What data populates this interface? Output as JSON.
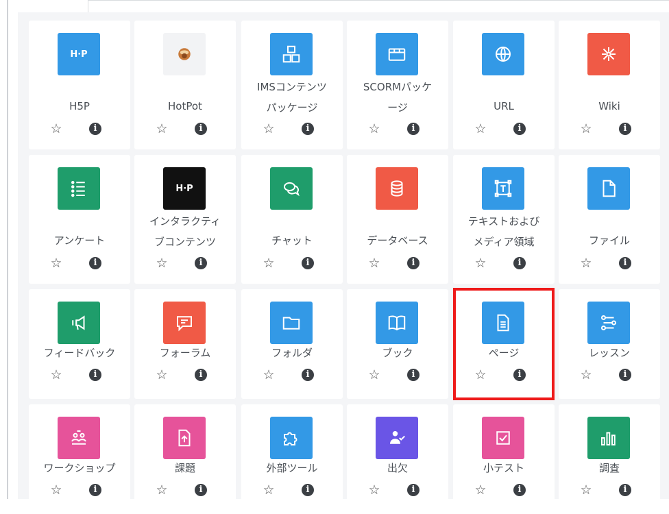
{
  "activities": [
    {
      "label": "H5P",
      "icon": "h5p-icon",
      "color": "#3399e6",
      "glyph": "H·P"
    },
    {
      "label": "HotPot",
      "icon": "hotpot-icon",
      "color": "#f2f3f5",
      "glyph": ""
    },
    {
      "label": "IMSコンテンツ\nパッケージ",
      "icon": "ims-package-icon",
      "color": "#3399e6",
      "glyph": ""
    },
    {
      "label": "SCORMパッケ\nージ",
      "icon": "scorm-package-icon",
      "color": "#3399e6",
      "glyph": ""
    },
    {
      "label": "URL",
      "icon": "globe-icon",
      "color": "#3399e6",
      "glyph": ""
    },
    {
      "label": "Wiki",
      "icon": "wiki-icon",
      "color": "#f05a46",
      "glyph": ""
    },
    {
      "label": "アンケート",
      "icon": "survey-list-icon",
      "color": "#1f9d6b",
      "glyph": ""
    },
    {
      "label": "インタラクティ\nブコンテンツ",
      "icon": "interactive-content-icon",
      "color": "#111111",
      "glyph": "H·P"
    },
    {
      "label": "チャット",
      "icon": "chat-bubbles-icon",
      "color": "#1f9d6b",
      "glyph": ""
    },
    {
      "label": "データベース",
      "icon": "database-icon",
      "color": "#f05a46",
      "glyph": ""
    },
    {
      "label": "テキストおよび\nメディア領域",
      "icon": "text-media-area-icon",
      "color": "#3399e6",
      "glyph": ""
    },
    {
      "label": "ファイル",
      "icon": "file-icon",
      "color": "#3399e6",
      "glyph": ""
    },
    {
      "label": "フィードバック",
      "icon": "megaphone-icon",
      "color": "#1f9d6b",
      "glyph": ""
    },
    {
      "label": "フォーラム",
      "icon": "forum-icon",
      "color": "#f05a46",
      "glyph": ""
    },
    {
      "label": "フォルダ",
      "icon": "folder-icon",
      "color": "#3399e6",
      "glyph": ""
    },
    {
      "label": "ブック",
      "icon": "book-icon",
      "color": "#3399e6",
      "glyph": ""
    },
    {
      "label": "ページ",
      "icon": "page-icon",
      "color": "#3399e6",
      "glyph": ""
    },
    {
      "label": "レッスン",
      "icon": "lesson-icon",
      "color": "#3399e6",
      "glyph": ""
    },
    {
      "label": "ワークショップ",
      "icon": "workshop-icon",
      "color": "#e6539a",
      "glyph": ""
    },
    {
      "label": "課題",
      "icon": "assignment-icon",
      "color": "#e6539a",
      "glyph": ""
    },
    {
      "label": "外部ツール",
      "icon": "puzzle-icon",
      "color": "#3399e6",
      "glyph": ""
    },
    {
      "label": "出欠",
      "icon": "attendance-icon",
      "color": "#6a55e6",
      "glyph": ""
    },
    {
      "label": "小テスト",
      "icon": "quiz-icon",
      "color": "#e6539a",
      "glyph": ""
    },
    {
      "label": "調査",
      "icon": "bar-chart-icon",
      "color": "#1f9d6b",
      "glyph": ""
    }
  ],
  "info_glyph": "i",
  "star_glyph": "☆",
  "highlight_color": "#ee1a1a"
}
